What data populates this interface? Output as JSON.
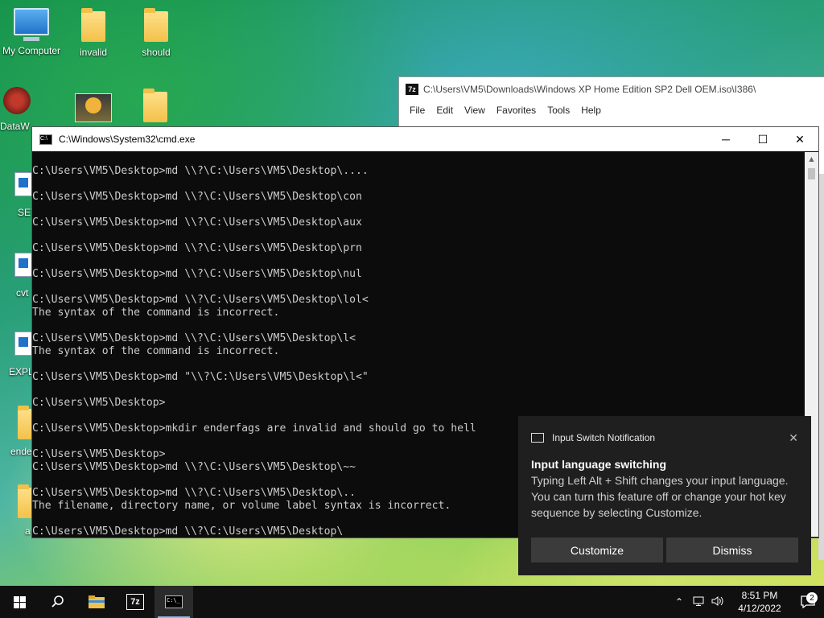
{
  "desktop": {
    "icons": [
      {
        "label": "My Computer",
        "type": "computer-icon"
      },
      {
        "label": "invalid",
        "type": "folder-icon"
      },
      {
        "label": "should",
        "type": "folder-icon"
      },
      {
        "label": "DataW",
        "type": "app-icon"
      }
    ],
    "partial_labels": [
      "SET",
      "cvt",
      "EXPL",
      "ende",
      "a"
    ]
  },
  "window_7z": {
    "title": "C:\\Users\\VM5\\Downloads\\Windows XP Home Edition SP2 Dell OEM.iso\\I386\\",
    "app_label": "7z",
    "menu": [
      "File",
      "Edit",
      "View",
      "Favorites",
      "Tools",
      "Help"
    ]
  },
  "cmd_window": {
    "title": "C:\\Windows\\System32\\cmd.exe",
    "controls": {
      "minimize": "─",
      "maximize": "☐",
      "close": "✕"
    },
    "lines": [
      "",
      "C:\\Users\\VM5\\Desktop>md \\\\?\\C:\\Users\\VM5\\Desktop\\....",
      "",
      "C:\\Users\\VM5\\Desktop>md \\\\?\\C:\\Users\\VM5\\Desktop\\con",
      "",
      "C:\\Users\\VM5\\Desktop>md \\\\?\\C:\\Users\\VM5\\Desktop\\aux",
      "",
      "C:\\Users\\VM5\\Desktop>md \\\\?\\C:\\Users\\VM5\\Desktop\\prn",
      "",
      "C:\\Users\\VM5\\Desktop>md \\\\?\\C:\\Users\\VM5\\Desktop\\nul",
      "",
      "C:\\Users\\VM5\\Desktop>md \\\\?\\C:\\Users\\VM5\\Desktop\\lol<",
      "The syntax of the command is incorrect.",
      "",
      "C:\\Users\\VM5\\Desktop>md \\\\?\\C:\\Users\\VM5\\Desktop\\l<",
      "The syntax of the command is incorrect.",
      "",
      "C:\\Users\\VM5\\Desktop>md \"\\\\?\\C:\\Users\\VM5\\Desktop\\l<\"",
      "",
      "C:\\Users\\VM5\\Desktop>",
      "",
      "C:\\Users\\VM5\\Desktop>mkdir enderfags are invalid and should go to hell",
      "",
      "C:\\Users\\VM5\\Desktop>",
      "C:\\Users\\VM5\\Desktop>md \\\\?\\C:\\Users\\VM5\\Desktop\\~~",
      "",
      "C:\\Users\\VM5\\Desktop>md \\\\?\\C:\\Users\\VM5\\Desktop\\..",
      "The filename, directory name, or volume label syntax is incorrect.",
      "",
      "C:\\Users\\VM5\\Desktop>md \\\\?\\C:\\Users\\VM5\\Desktop\\"
    ]
  },
  "notification": {
    "source": "Input Switch Notification",
    "heading": "Input language switching",
    "body": "Typing Left Alt + Shift changes your input language. You can turn this feature off or change your hot key sequence by selecting Customize.",
    "customize_label": "Customize",
    "dismiss_label": "Dismiss"
  },
  "taskbar": {
    "apps": [
      "start-icon",
      "search-icon",
      "file-explorer-icon",
      "7zip-icon",
      "cmd-icon"
    ],
    "app_7z_label": "7z",
    "clock_time": "8:51 PM",
    "clock_date": "4/12/2022",
    "notification_count": "2"
  }
}
